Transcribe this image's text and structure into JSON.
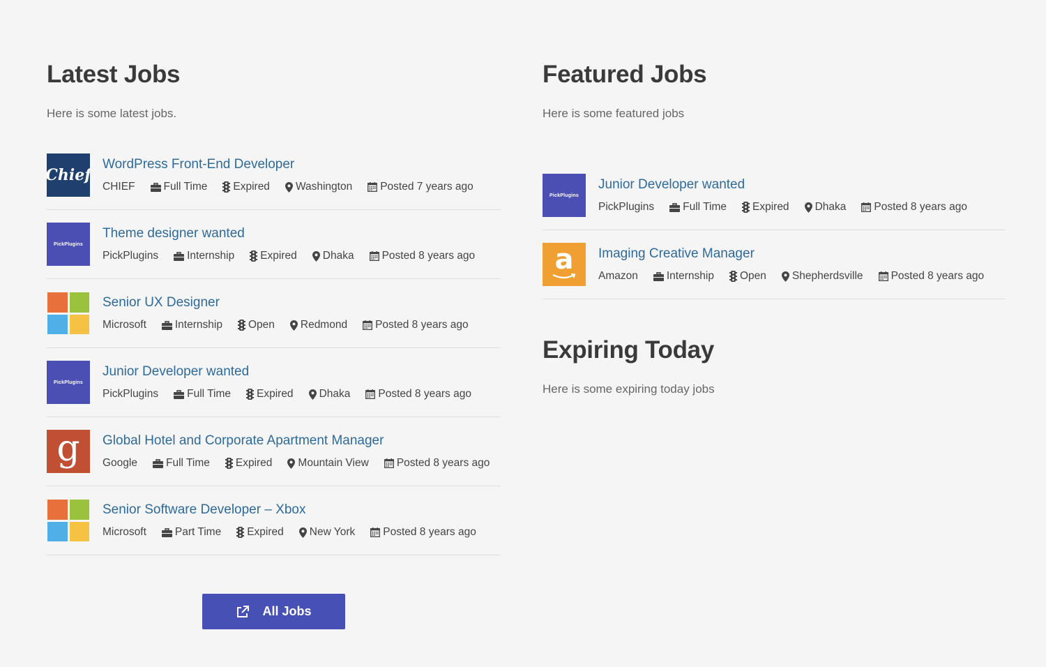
{
  "latest": {
    "title": "Latest Jobs",
    "description": "Here is some latest jobs.",
    "jobs": [
      {
        "title": "WordPress Front-End Developer",
        "company": "CHIEF",
        "type": "Full Time",
        "status": "Expired",
        "location": "Washington",
        "posted": "Posted 7 years ago",
        "logo": "chief",
        "logo_text": "Chief"
      },
      {
        "title": "Theme designer wanted",
        "company": "PickPlugins",
        "type": "Internship",
        "status": "Expired",
        "location": "Dhaka",
        "posted": "Posted 8 years ago",
        "logo": "pickplugins",
        "logo_text": "PickPlugins"
      },
      {
        "title": "Senior UX Designer",
        "company": "Microsoft",
        "type": "Internship",
        "status": "Open",
        "location": "Redmond",
        "posted": "Posted 8 years ago",
        "logo": "microsoft",
        "logo_text": ""
      },
      {
        "title": "Junior Developer wanted",
        "company": "PickPlugins",
        "type": "Full Time",
        "status": "Expired",
        "location": "Dhaka",
        "posted": "Posted 8 years ago",
        "logo": "pickplugins",
        "logo_text": "PickPlugins"
      },
      {
        "title": "Global Hotel and Corporate Apartment Manager",
        "company": "Google",
        "type": "Full Time",
        "status": "Expired",
        "location": "Mountain View",
        "posted": "Posted 8 years ago",
        "logo": "google",
        "logo_text": "g"
      },
      {
        "title": "Senior Software Developer – Xbox",
        "company": "Microsoft",
        "type": "Part Time",
        "status": "Expired",
        "location": "New York",
        "posted": "Posted 8 years ago",
        "logo": "microsoft",
        "logo_text": ""
      }
    ],
    "button_label": "All Jobs"
  },
  "featured": {
    "title": "Featured Jobs",
    "description": "Here is some featured jobs",
    "jobs": [
      {
        "title": "Junior Developer wanted",
        "company": "PickPlugins",
        "type": "Full Time",
        "status": "Expired",
        "location": "Dhaka",
        "posted": "Posted 8 years ago",
        "logo": "pickplugins",
        "logo_text": "PickPlugins"
      },
      {
        "title": "Imaging Creative Manager",
        "company": "Amazon",
        "type": "Internship",
        "status": "Open",
        "location": "Shepherdsville",
        "posted": "Posted 8 years ago",
        "logo": "amazon",
        "logo_text": "a"
      }
    ]
  },
  "expiring": {
    "title": "Expiring Today",
    "description": "Here is some expiring today jobs"
  },
  "colors": {
    "link": "#2e6a9a",
    "button": "#4750b4",
    "ms_red": "#e8703a",
    "ms_green": "#9bc23c",
    "ms_blue": "#4fb0e8",
    "ms_yellow": "#f6c244"
  },
  "icons": {
    "type": "briefcase-icon",
    "status": "traffic-light-icon",
    "location": "map-marker-icon",
    "posted": "calendar-icon",
    "button": "external-link-icon"
  }
}
